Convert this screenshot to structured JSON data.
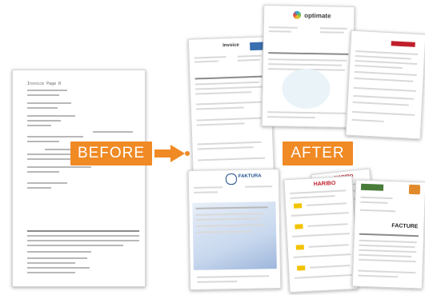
{
  "labels": {
    "before": "BEFORE",
    "after": "AFTER"
  },
  "docs": {
    "optimate_brand": "optimate",
    "invoice_title": "Invoice",
    "faktura_title": "FAKTURA",
    "facture_title": "FACTURE",
    "haribo_brand": "HARIBO",
    "before_text": "Invoice Page  R"
  },
  "colors": {
    "arrow": "#f08a24",
    "label_bg": "#f08a24"
  }
}
